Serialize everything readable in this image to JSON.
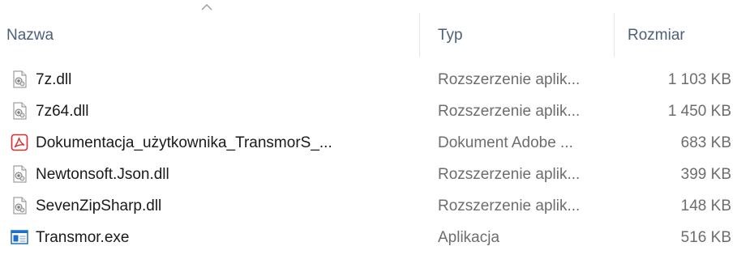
{
  "columns": {
    "name": "Nazwa",
    "type": "Typ",
    "size": "Rozmiar",
    "sorted_by": "name",
    "sort_direction": "ascending"
  },
  "files": [
    {
      "name": "7z.dll",
      "type": "Rozszerzenie aplik...",
      "size": "1 103 KB",
      "icon": "dll-file-icon"
    },
    {
      "name": "7z64.dll",
      "type": "Rozszerzenie aplik...",
      "size": "1 450 KB",
      "icon": "dll-file-icon"
    },
    {
      "name": "Dokumentacja_użytkownika_TransmorS_...",
      "type": "Dokument Adobe ...",
      "size": "683 KB",
      "icon": "pdf-file-icon"
    },
    {
      "name": "Newtonsoft.Json.dll",
      "type": "Rozszerzenie aplik...",
      "size": "399 KB",
      "icon": "dll-file-icon"
    },
    {
      "name": "SevenZipSharp.dll",
      "type": "Rozszerzenie aplik...",
      "size": "148 KB",
      "icon": "dll-file-icon"
    },
    {
      "name": "Transmor.exe",
      "type": "Aplikacja",
      "size": "516 KB",
      "icon": "exe-file-icon"
    }
  ],
  "colors": {
    "header_text": "#4c607a",
    "name_text": "#1a1a1a",
    "detail_text": "#6d6d6d",
    "pdf_red": "#d32f2f",
    "exe_blue": "#1e6fc9"
  }
}
